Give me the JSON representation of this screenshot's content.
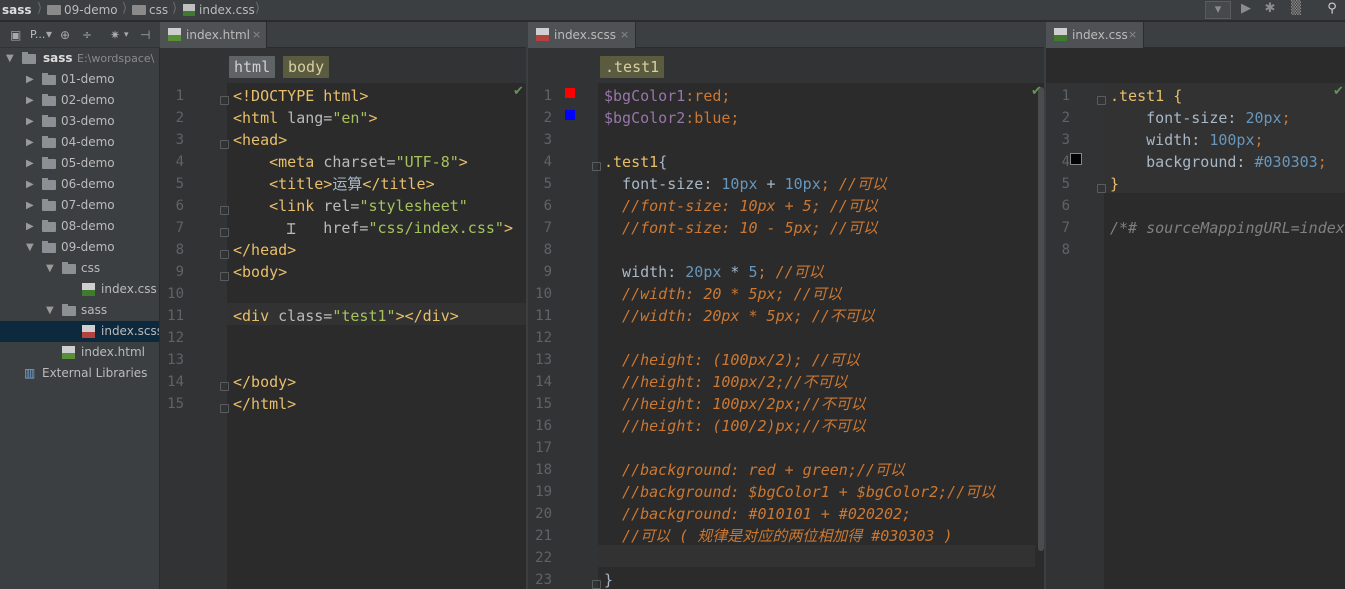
{
  "breadcrumb": {
    "project": "sass",
    "folder1": "09-demo",
    "folder2": "css",
    "file": "index.css"
  },
  "project_panel": {
    "title": "P...",
    "root_label": "sass",
    "root_path": "E:\\wordspace\\"
  },
  "tree": [
    {
      "label": "01-demo",
      "type": "folder",
      "open": false
    },
    {
      "label": "02-demo",
      "type": "folder",
      "open": false
    },
    {
      "label": "03-demo",
      "type": "folder",
      "open": false
    },
    {
      "label": "04-demo",
      "type": "folder",
      "open": false
    },
    {
      "label": "05-demo",
      "type": "folder",
      "open": false
    },
    {
      "label": "06-demo",
      "type": "folder",
      "open": false
    },
    {
      "label": "07-demo",
      "type": "folder",
      "open": false
    },
    {
      "label": "08-demo",
      "type": "folder",
      "open": false
    },
    {
      "label": "09-demo",
      "type": "folder",
      "open": true
    },
    {
      "label": "css",
      "type": "folder",
      "open": true
    },
    {
      "label": "index.css",
      "type": "css"
    },
    {
      "label": "sass",
      "type": "folder",
      "open": true
    },
    {
      "label": "index.scss",
      "type": "scss",
      "selected": true
    },
    {
      "label": "index.html",
      "type": "html"
    },
    {
      "label": "External Libraries",
      "type": "lib"
    }
  ],
  "editor1": {
    "tab": "index.html",
    "crumbs": [
      "html",
      "body"
    ],
    "lines": [
      [
        [
          "<!DOCTYPE html>",
          "tg"
        ]
      ],
      [
        [
          "<html ",
          "tg"
        ],
        [
          "lang=",
          "at"
        ],
        [
          "\"en\"",
          "st"
        ],
        [
          ">",
          "tg"
        ]
      ],
      [
        [
          "<head>",
          "tg"
        ]
      ],
      [
        [
          "    <meta ",
          "tg"
        ],
        [
          "charset=",
          "at"
        ],
        [
          "\"UTF-8\"",
          "st"
        ],
        [
          ">",
          "tg"
        ]
      ],
      [
        [
          "    <title>",
          "tg"
        ],
        [
          "运算",
          "tx"
        ],
        [
          "</title>",
          "tg"
        ]
      ],
      [
        [
          "    <link ",
          "tg"
        ],
        [
          "rel=",
          "at"
        ],
        [
          "\"stylesheet\"",
          "st"
        ]
      ],
      [
        [
          "          href=",
          "at"
        ],
        [
          "\"css/index.css\"",
          "st"
        ],
        [
          ">",
          "tg"
        ]
      ],
      [
        [
          "</head>",
          "tg"
        ]
      ],
      [
        [
          "<body>",
          "tg"
        ]
      ],
      [
        [
          "",
          ""
        ]
      ],
      [
        [
          "<div ",
          "tg"
        ],
        [
          "class=",
          "at"
        ],
        [
          "\"test1\"",
          "st"
        ],
        [
          "></div>",
          "tg"
        ]
      ],
      [
        [
          "",
          ""
        ]
      ],
      [
        [
          "",
          ""
        ]
      ],
      [
        [
          "</body>",
          "tg"
        ]
      ],
      [
        [
          "</html>",
          "tg"
        ]
      ]
    ]
  },
  "editor2": {
    "tab": "index.scss",
    "crumbs": [
      ".test1"
    ],
    "lines": [
      [
        [
          "$bgColor1",
          "vr"
        ],
        [
          ":red;",
          "kw"
        ]
      ],
      [
        [
          "$bgColor2",
          "vr"
        ],
        [
          ":blue;",
          "kw"
        ]
      ],
      [
        [
          "",
          ""
        ]
      ],
      [
        [
          ".test1",
          "sel2"
        ],
        [
          "{",
          "tx"
        ]
      ],
      [
        [
          "  font-size: ",
          "tx"
        ],
        [
          "10px",
          "nm"
        ],
        [
          " + ",
          "tx"
        ],
        [
          "10px",
          "nm"
        ],
        [
          "; ",
          "kw"
        ],
        [
          "//可以",
          "cm"
        ]
      ],
      [
        [
          "  //font-size: 10px + 5; //可以",
          "cm"
        ]
      ],
      [
        [
          "  //font-size: 10 - 5px; //可以",
          "cm"
        ]
      ],
      [
        [
          "",
          ""
        ]
      ],
      [
        [
          "  width: ",
          "tx"
        ],
        [
          "20px",
          "nm"
        ],
        [
          " * ",
          "tx"
        ],
        [
          "5",
          "nm"
        ],
        [
          "; ",
          "kw"
        ],
        [
          "//可以",
          "cm"
        ]
      ],
      [
        [
          "  //width: 20 * 5px; //可以",
          "cm"
        ]
      ],
      [
        [
          "  //width: 20px * 5px; //不可以",
          "cm"
        ]
      ],
      [
        [
          "",
          ""
        ]
      ],
      [
        [
          "  //height: (100px/2); //可以",
          "cm"
        ]
      ],
      [
        [
          "  //height: 100px/2;//不可以",
          "cm"
        ]
      ],
      [
        [
          "  //height: 100px/2px;//不可以",
          "cm"
        ]
      ],
      [
        [
          "  //height: (100/2)px;//不可以",
          "cm"
        ]
      ],
      [
        [
          "",
          ""
        ]
      ],
      [
        [
          "  //background: red + green;//可以",
          "cm"
        ]
      ],
      [
        [
          "  //background: $bgColor1 + $bgColor2;//可以",
          "cm"
        ]
      ],
      [
        [
          "  //background: #010101 + #020202;",
          "cm"
        ]
      ],
      [
        [
          "  //可以 ( 规律是对应的两位相加得 #030303 )",
          "cm"
        ]
      ],
      [
        [
          "",
          ""
        ]
      ],
      [
        [
          "}",
          "tx"
        ]
      ]
    ]
  },
  "editor3": {
    "tab": "index.css",
    "lines": [
      [
        [
          ".test1 ",
          "sel2"
        ],
        [
          "{",
          "tg"
        ]
      ],
      [
        [
          "    font-size: ",
          "tx"
        ],
        [
          "20px",
          "nm"
        ],
        [
          ";",
          "kw"
        ]
      ],
      [
        [
          "    width: ",
          "tx"
        ],
        [
          "100px",
          "nm"
        ],
        [
          ";",
          "kw"
        ]
      ],
      [
        [
          "    background: ",
          "tx"
        ],
        [
          "#030303",
          "nm"
        ],
        [
          ";",
          "kw"
        ]
      ],
      [
        [
          "}",
          "tg"
        ]
      ],
      [
        [
          "",
          ""
        ]
      ],
      [
        [
          "/*# sourceMappingURL=index.css.map */",
          "cmg"
        ]
      ],
      [
        [
          "",
          ""
        ]
      ]
    ]
  },
  "colors": {
    "red_swatch": "#ff0000",
    "blue_swatch": "#0000ff",
    "black_swatch": "#030303"
  }
}
